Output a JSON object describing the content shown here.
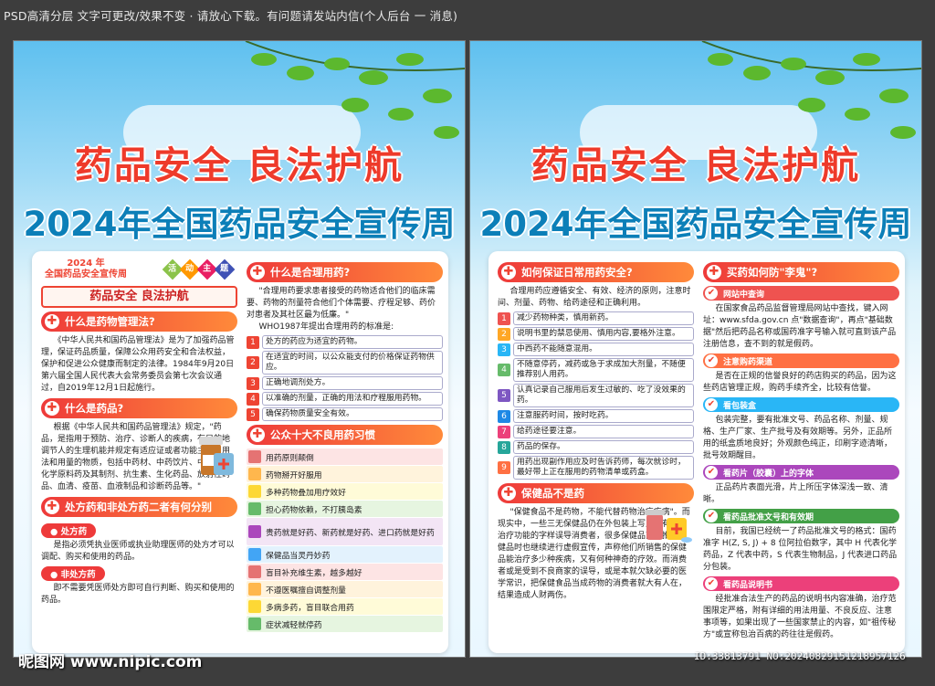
{
  "topbar": "PSD高清分层 文字可更改/效果不变 · 请放心下载。有问题请发站内信(个人后台 一 消息)",
  "title1": "药品安全 良法护航",
  "title2": "2024年全国药品安全宣传周",
  "left": {
    "badge_year": "2024 年",
    "badge_name": "全国药品安全宣传周",
    "activity": [
      "活",
      "动",
      "主",
      "题"
    ],
    "slogan": "药品安全 良法护航",
    "h1": "什么是药物管理法?",
    "t1": "《中华人民共和国药品管理法》是为了加强药品管理，保证药品质量，保障公众用药安全和合法权益，保护和促进公众健康而制定的法律。1984年9月20日第六届全国人民代表大会常务委员会第七次会议通过，自2019年12月1日起施行。",
    "h2": "什么是药品?",
    "t2": "根据《中华人民共和国药品管理法》规定，\"药品，是指用于预防、治疗、诊断人的疾病，有目的地调节人的生理机能并规定有适应证或者功能主治、用法和用量的物质，包括中药材、中药饮片、中成药、化学原料药及其制剂、抗生素、生化药品、放射性药品、血清、疫苗、血液制品和诊断药品等。\"",
    "h3": "处方药和非处方药二者有何分别",
    "s1": "处方药",
    "t3": "是指必须凭执业医师或执业助理医师的处方才可以调配、购买和使用的药品。",
    "s2": "非处方药",
    "t4": "即不需要凭医师处方即可自行判断、购买和使用的药品。",
    "h4": "什么是合理用药?",
    "t5": "\"合理用药要求患者接受的药物适合他们的临床需要、药物的剂量符合他们个体需要、疗程足够、药价对患者及其社区最为低廉。\"",
    "t6": "WHO1987年提出合理用药的标准是:",
    "std": [
      "处方的药应为适宜的药物。",
      "在适宜的时间，以公众能支付的价格保证药物供应。",
      "正确地调剂处方。",
      "以准确的剂量，正确的用法和疗程服用药物。",
      "确保药物质量安全有效。"
    ],
    "h5": "公众十大不良用药习惯",
    "habits": [
      "用药原则颠倒",
      "药物掰开好服用",
      "多种药物叠加用疗效好",
      "担心药物依赖，不打胰岛素",
      "贵药就是好药、新药就是好药、进口药就是好药",
      "保健品当灵丹妙药",
      "盲目补充维生素，越多越好",
      "不遵医嘱擅自调整剂量",
      "多病多药，盲目联合用药",
      "症状减轻就停药"
    ]
  },
  "right": {
    "h1": "如何保证日常用药安全?",
    "t1": "合理用药应遵循安全、有效、经济的原则，注意时间、剂量、药物、给药途径和正确利用。",
    "tips": [
      "减少药物种类，慎用新药。",
      "说明书里的禁忌使用、慎用内容,要格外注意。",
      "中西药不能随意混用。",
      "不随意停药，减药或急于求成加大剂量，不随便推荐别人用药。",
      "认真记录自己服用后发生过敏的、吃了没效果的药。",
      "注意服药时间，按时吃药。",
      "给药途径要注意。",
      "药品的保存。",
      "用药出现副作用应及时告诉药师，每次就诊时，最好带上正在服用的药物清单或药盒。"
    ],
    "h2": "保健品不是药",
    "t2": "\"保健食品不是药物，不能代替药物治疗疾病\"。而现实中，一些三无保健品仍在外包装上写上具有药物治疗功能的字样误导消费者，很多保健品商家推销保健品时也继续进行虚假宣传，声称他们所销售的保健品能治疗多少种疾病，又有何种神奇的疗效。而消费者或是受到不良商家的误导，或是本就欠缺必要的医学常识，把保健食品当成药物的消费者就大有人在，结果造成人财两伤。",
    "h3": "买药如何防\"李鬼\"?",
    "c1": "网站中查询",
    "ct1": "在国家食品药品监督管理局网站中查找，键入网址：www.sfda.gov.cn 点\"数据查询\"，再点\"基础数据\"然后把药品名称或国药准字号输入就可直到该产品注册信息，查不到的就是假药。",
    "c2": "注意购药渠道",
    "ct2": "是否在正规的信誉良好的药店购买的药品，因为这些药店管理正规，购药手续齐全，比较有信誉。",
    "c3": "看包装盒",
    "ct3": "包装完整，要有批准文号、药品名称、剂量、规格、生产厂家、生产批号及有效期等。另外，正品所用的纸盒质地良好；外观颜色纯正，印刷字迹清晰，批号效期醒目。",
    "c4": "看药片（胶囊）上的字体",
    "ct4": "正品药片表面光滑，片上所压字体深浅一致、清晰。",
    "c5": "看药品批准文号和有效期",
    "ct5": "目前，我国已经统一了药品批准文号的格式：国药准字 H(Z, S, J) + 8 位阿拉伯数字，其中 H 代表化学药品，Z 代表中药，S 代表生物制品，J 代表进口药品分包装。",
    "c6": "看药品说明书",
    "ct6": "经批准合法生产的药品的说明书内容准确，治疗范围限定严格，附有详细的用法用量、不良反应、注意事项等，如果出现了一些国家禁止的内容，如\"祖传秘方\"或宣称包治百病的药往往是假药。"
  },
  "watermark_left": "昵图网 www.nipic.com",
  "watermark_right": "ID:33813791 NO:20240829151218957126",
  "colors": {
    "red": "#ee3a2a",
    "blue": "#0c7fb8"
  }
}
